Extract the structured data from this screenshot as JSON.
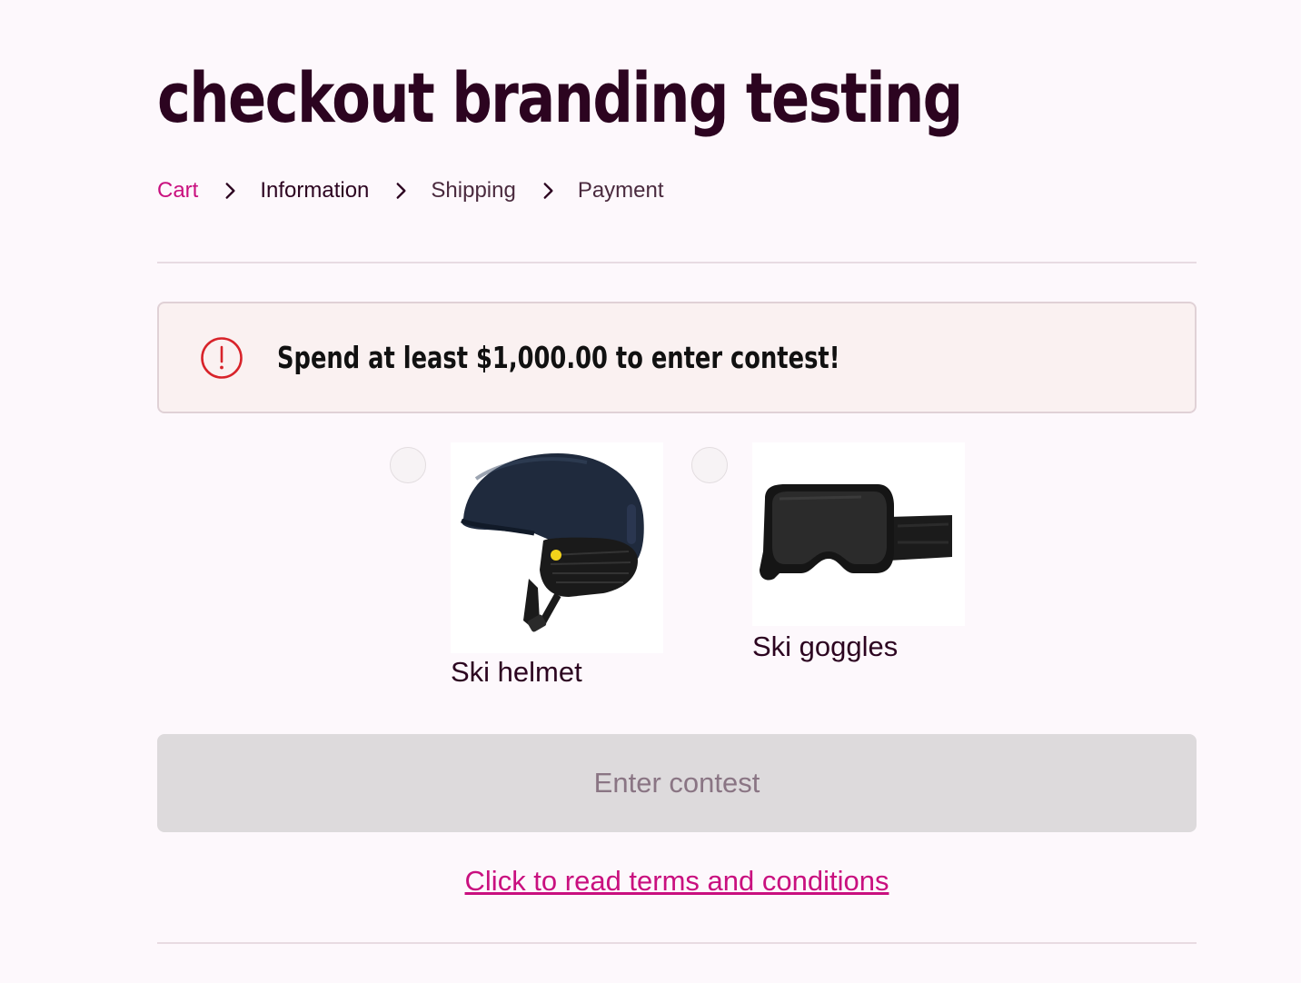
{
  "shop": {
    "title": "checkout branding testing"
  },
  "breadcrumb": {
    "items": [
      {
        "label": "Cart",
        "state": "link"
      },
      {
        "label": "Information",
        "state": "current"
      },
      {
        "label": "Shipping",
        "state": "upcoming"
      },
      {
        "label": "Payment",
        "state": "upcoming"
      }
    ]
  },
  "banner": {
    "icon": "exclamation-circle-icon",
    "message": "Spend at least $1,000.00 to enter contest!",
    "icon_color": "#d8232a"
  },
  "contest": {
    "options": [
      {
        "label": "Ski helmet",
        "image": "ski-helmet-image",
        "selected": false
      },
      {
        "label": "Ski goggles",
        "image": "ski-goggles-image",
        "selected": false
      }
    ],
    "submit_label": "Enter contest",
    "submit_disabled": true,
    "terms_link": "Click to read terms and conditions"
  },
  "colors": {
    "accent": "#c9107f",
    "heading": "#2c0420",
    "background": "#fdf8fc",
    "banner_bg": "#faf1f1",
    "button_disabled_bg": "#dddadc"
  }
}
